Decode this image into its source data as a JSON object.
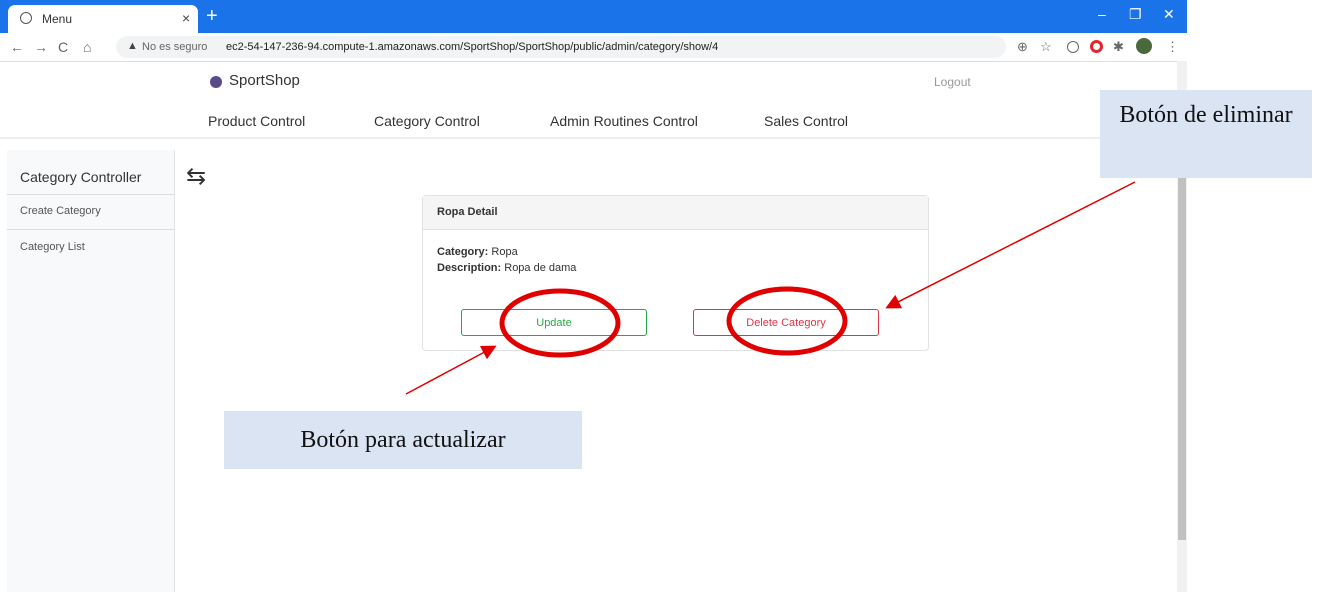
{
  "browser": {
    "tab_title": "Menu",
    "tab_close": "×",
    "new_tab": "+",
    "security_label": "No es seguro",
    "url": "ec2-54-147-236-94.compute-1.amazonaws.com/SportShop/SportShop/public/admin/category/show/4",
    "warning_icon": "▲",
    "back_icon": "←",
    "forward_icon": "→",
    "reload_icon": "C",
    "home_icon": "⌂",
    "zoom_icon": "⊕",
    "star_icon": "☆",
    "menu_icon": "⋮",
    "minimize": "–",
    "restore": "❐",
    "close": "✕"
  },
  "header": {
    "brand": "SportShop",
    "logout": "Logout",
    "nav": [
      "Product Control",
      "Category Control",
      "Admin Routines Control",
      "Sales Control"
    ]
  },
  "sidebar": {
    "title": "Category Controller",
    "items": [
      "Create Category",
      "Category List"
    ],
    "toggle_icon": "⇆"
  },
  "card": {
    "title": "Ropa Detail",
    "category_label": "Category:",
    "category_value": "Ropa",
    "description_label": "Description:",
    "description_value": "Ropa de dama",
    "update_label": "Update",
    "delete_label": "Delete Category"
  },
  "annotations": {
    "delete_note": "Botón de eliminar",
    "update_note": "Botón para actualizar"
  },
  "colors": {
    "accent": "#1a73e8",
    "update": "#28a745",
    "delete": "#dc3545",
    "annotation_red": "#e00000"
  }
}
